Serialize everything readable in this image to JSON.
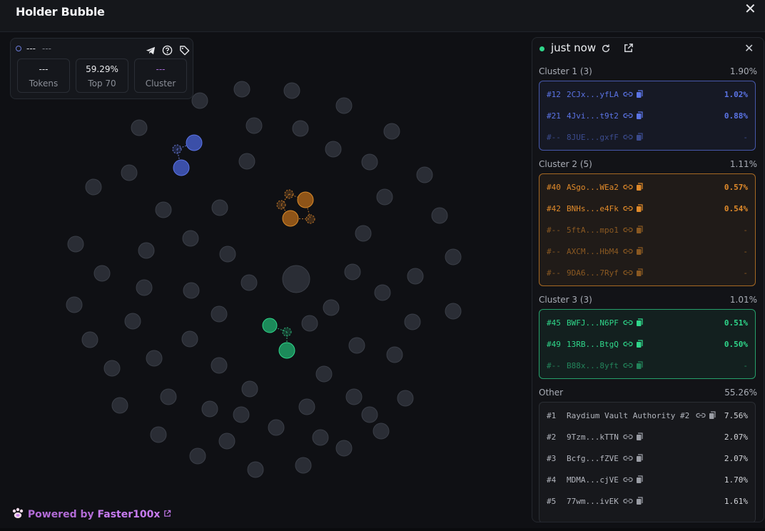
{
  "header": {
    "title": "Holder Bubble",
    "close_icon": "close-icon"
  },
  "stats": {
    "label": "---",
    "sub": "---",
    "icons": [
      "telegram-icon",
      "help-icon",
      "tag-icon"
    ],
    "boxes": [
      {
        "value": "---",
        "label": "Tokens"
      },
      {
        "value": "59.29%",
        "label": "Top 70"
      },
      {
        "value": "---",
        "label": "Cluster"
      }
    ]
  },
  "panel": {
    "time": "just now",
    "icons": [
      "refresh-icon",
      "external-link-icon",
      "close-icon"
    ],
    "clusters": [
      {
        "title": "Cluster 1 (3)",
        "percent": "1.90%",
        "color": "#5b74e6",
        "rows": [
          {
            "rank": "#12",
            "address": "2CJx...yfLA",
            "percent": "1.02%"
          },
          {
            "rank": "#21",
            "address": "4Jvi...t9t2",
            "percent": "0.88%"
          },
          {
            "rank": "#--",
            "address": "8JUE...gxfF",
            "percent": "-"
          }
        ]
      },
      {
        "title": "Cluster 2 (5)",
        "percent": "1.11%",
        "color": "#e08a2a",
        "rows": [
          {
            "rank": "#40",
            "address": "ASgo...WEa2",
            "percent": "0.57%"
          },
          {
            "rank": "#42",
            "address": "BNHs...e4Fk",
            "percent": "0.54%"
          },
          {
            "rank": "#--",
            "address": "5ftA...mpo1",
            "percent": "-"
          },
          {
            "rank": "#--",
            "address": "AXCM...HbM4",
            "percent": "-"
          },
          {
            "rank": "#--",
            "address": "9DA6...7Ryf",
            "percent": "-"
          }
        ]
      },
      {
        "title": "Cluster 3 (3)",
        "percent": "1.01%",
        "color": "#2fd68a",
        "rows": [
          {
            "rank": "#45",
            "address": "BWFJ...N6PF",
            "percent": "0.51%"
          },
          {
            "rank": "#49",
            "address": "13RB...BtgQ",
            "percent": "0.50%"
          },
          {
            "rank": "#--",
            "address": "B88x...8yft",
            "percent": "-"
          }
        ]
      }
    ],
    "other": {
      "title": "Other",
      "percent": "55.26%",
      "rows": [
        {
          "rank": "#1",
          "address": "Raydium Vault Authority #2",
          "percent": "7.56%"
        },
        {
          "rank": "#2",
          "address": "9Tzm...kTTN",
          "percent": "2.07%"
        },
        {
          "rank": "#3",
          "address": "Bcfg...fZVE",
          "percent": "2.07%"
        },
        {
          "rank": "#4",
          "address": "MDMA...cjVE",
          "percent": "1.70%"
        },
        {
          "rank": "#5",
          "address": "77wm...ivEK",
          "percent": "1.61%"
        }
      ]
    }
  },
  "footer": {
    "powered": "Powered by",
    "brand": "Faster100x",
    "logo_icon": "paw-logo-icon",
    "link_icon": "external-link-icon"
  }
}
